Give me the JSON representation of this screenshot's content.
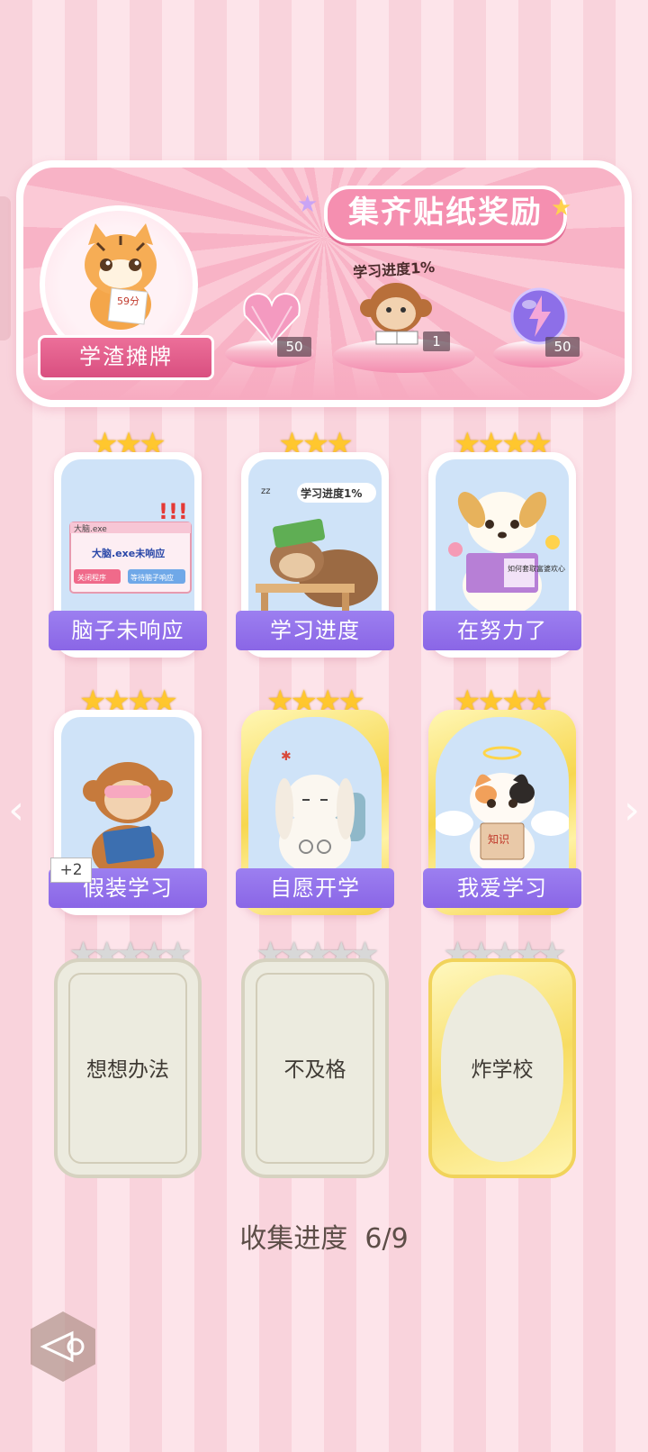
{
  "banner": {
    "title": "集齐贴纸奖励",
    "avatar_name": "学渣摊牌",
    "avatar_paper_text": "59分",
    "progress_tag": "学习进度1%",
    "rewards": [
      {
        "icon": "heart-gem-icon",
        "count": "50"
      },
      {
        "icon": "monkey-reading-icon",
        "count": "1"
      },
      {
        "icon": "lightning-orb-icon",
        "count": "50"
      }
    ]
  },
  "cards": [
    {
      "label": "脑子未响应",
      "stars": "★★★",
      "rarity": "normal",
      "art_text": [
        "大脑.exe",
        "大脑.exe未响应",
        "关闭程序",
        "等待脑子响应"
      ]
    },
    {
      "label": "学习进度",
      "stars": "★★★",
      "rarity": "normal",
      "art_text": [
        "学习进度1%",
        "zz"
      ]
    },
    {
      "label": "在努力了",
      "stars": "★★★★",
      "rarity": "normal",
      "art_text": [
        "如何套取富婆欢心"
      ]
    },
    {
      "label": "假装学习",
      "stars": "★★★★",
      "rarity": "normal",
      "badge": "+2"
    },
    {
      "label": "自愿开学",
      "stars": "★★★★",
      "rarity": "gold"
    },
    {
      "label": "我爱学习",
      "stars": "★★★★",
      "rarity": "gold",
      "art_text": [
        "知识"
      ]
    }
  ],
  "locked_cards": [
    {
      "label": "想想办法",
      "stars": "★★★★★"
    },
    {
      "label": "不及格",
      "stars": "★★★★★"
    },
    {
      "label": "炸学校",
      "stars": "★★★★★"
    }
  ],
  "progress": {
    "label": "收集进度",
    "value": "6/9"
  },
  "colors": {
    "accent_purple": "#8a66e6",
    "pink": "#f58fb0",
    "gold": "#f7d74f"
  }
}
